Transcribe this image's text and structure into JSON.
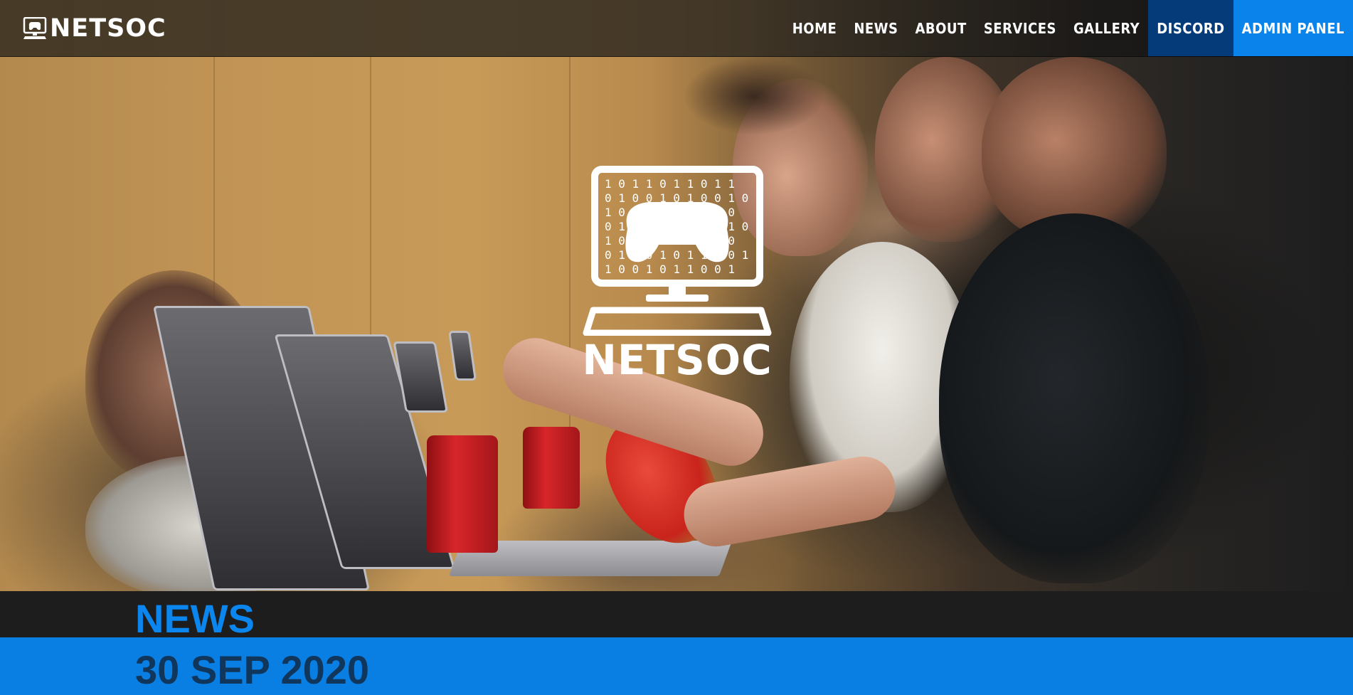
{
  "brand": {
    "name": "NETSOC",
    "icon": "gamepad-monitor-icon"
  },
  "nav": {
    "items": [
      {
        "label": "HOME"
      },
      {
        "label": "NEWS"
      },
      {
        "label": "ABOUT"
      },
      {
        "label": "SERVICES"
      },
      {
        "label": "GALLERY"
      },
      {
        "label": "DISCORD"
      },
      {
        "label": "ADMIN PANEL"
      }
    ]
  },
  "hero": {
    "logo_text": "NETSOC",
    "logo_icon": "gamepad-monitor-icon",
    "image": "students-with-laptops-photo"
  },
  "news": {
    "heading": "NEWS",
    "date": "30 SEP 2020"
  },
  "colors": {
    "accent": "#0a84ea",
    "discord": "#043b78",
    "news_heading": "#0b86ee",
    "news_band": "#0a7fe3",
    "date_text": "#10365c"
  }
}
